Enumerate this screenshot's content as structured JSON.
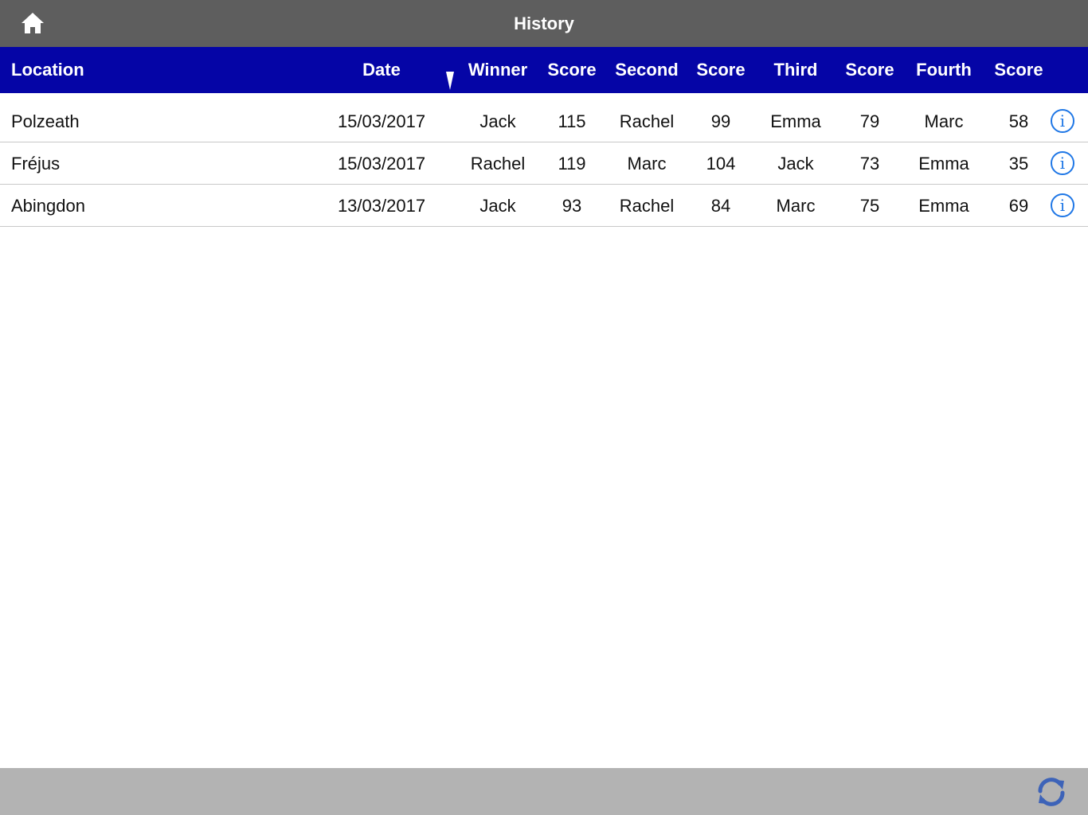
{
  "header": {
    "title": "History"
  },
  "columns": {
    "location": "Location",
    "date": "Date",
    "winner": "Winner",
    "score1": "Score",
    "second": "Second",
    "score2": "Score",
    "third": "Third",
    "score3": "Score",
    "fourth": "Fourth",
    "score4": "Score"
  },
  "rows": [
    {
      "location": "Polzeath",
      "date": "15/03/2017",
      "winner": "Jack",
      "score1": "115",
      "second": "Rachel",
      "score2": "99",
      "third": "Emma",
      "score3": "79",
      "fourth": "Marc",
      "score4": "58"
    },
    {
      "location": "Fréjus",
      "date": "15/03/2017",
      "winner": "Rachel",
      "score1": "119",
      "second": "Marc",
      "score2": "104",
      "third": "Jack",
      "score3": "73",
      "fourth": "Emma",
      "score4": "35"
    },
    {
      "location": "Abingdon",
      "date": "13/03/2017",
      "winner": "Jack",
      "score1": "93",
      "second": "Rachel",
      "score2": "84",
      "third": "Marc",
      "score3": "75",
      "fourth": "Emma",
      "score4": "69"
    }
  ],
  "icons": {
    "home": "home-icon",
    "sort": "sort-descending-icon",
    "info": "info-icon",
    "refresh": "refresh-icon"
  },
  "colors": {
    "topbar": "#5e5e5e",
    "header_row": "#0505a6",
    "bottombar": "#b3b3b3",
    "accent": "#1f77e6"
  }
}
